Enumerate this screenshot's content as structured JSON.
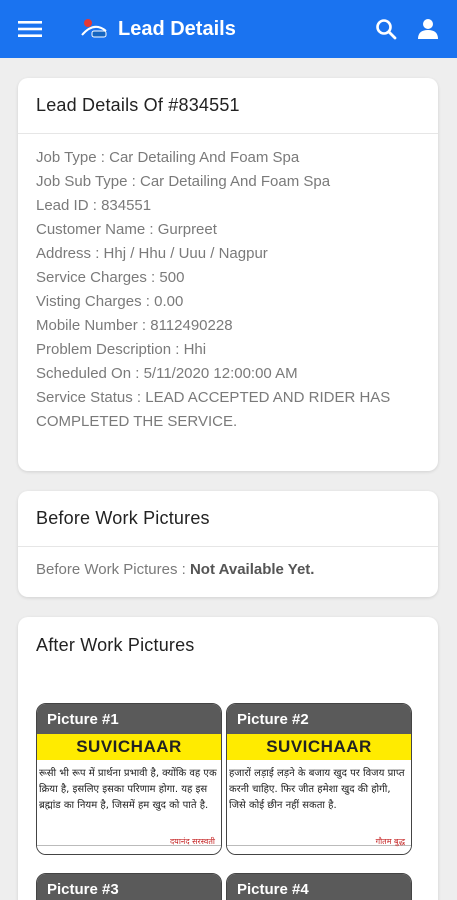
{
  "appbar": {
    "title": "Lead Details",
    "icons": [
      "menu-icon",
      "logo-icon",
      "search-icon",
      "account-icon"
    ]
  },
  "lead": {
    "header": "Lead Details Of #834551",
    "fields": [
      {
        "label": "Job Type",
        "value": "Car Detailing And Foam Spa"
      },
      {
        "label": "Job Sub Type",
        "value": "Car Detailing And Foam Spa"
      },
      {
        "label": "Lead ID",
        "value": "834551"
      },
      {
        "label": "Customer Name",
        "value": "Gurpreet"
      },
      {
        "label": "Address",
        "value": "Hhj / Hhu / Uuu / Nagpur"
      },
      {
        "label": "Service Charges",
        "value": "500"
      },
      {
        "label": "Visting Charges",
        "value": "0.00"
      },
      {
        "label": "Mobile Number",
        "value": "8112490228"
      },
      {
        "label": "Problem Description",
        "value": "Hhi"
      },
      {
        "label": "Scheduled On",
        "value": "5/11/2020 12:00:00 AM"
      },
      {
        "label": "Service Status",
        "value": "LEAD ACCEPTED AND RIDER HAS COMPLETED THE SERVICE."
      }
    ]
  },
  "before": {
    "header": "Before Work Pictures",
    "label": "Before Work Pictures",
    "value": "Not Available Yet."
  },
  "after": {
    "header": "After Work Pictures",
    "pictures": [
      {
        "title": "Picture #1",
        "banner": "SUVICHAAR",
        "quote": [
          "रूसी भी रूप में प्रार्थना प्रभावी है, क्योंकि वह एक",
          "क्रिया है, इसलिए इसका परिणाम होगा. यह इस",
          "ब्रह्मांड का नियम है, जिसमें हम खुद को पाते है."
        ],
        "author": "दयानंद सरस्वती"
      },
      {
        "title": "Picture #2",
        "banner": "SUVICHAAR",
        "quote": [
          "हजारों लड़ाई लड़ने के बजाय खुद पर विजय प्राप्त",
          "करनी चाहिए. फिर जीत हमेशा खुद की होगी,",
          "जिसे कोई छीन नहीं सकता है."
        ],
        "author": "गौतम बुद्ध"
      },
      {
        "title": "Picture #3"
      },
      {
        "title": "Picture #4"
      }
    ]
  },
  "colors": {
    "primary": "#1a73f0",
    "banner": "#ffeb00",
    "picture_header": "#5a5a5a"
  }
}
